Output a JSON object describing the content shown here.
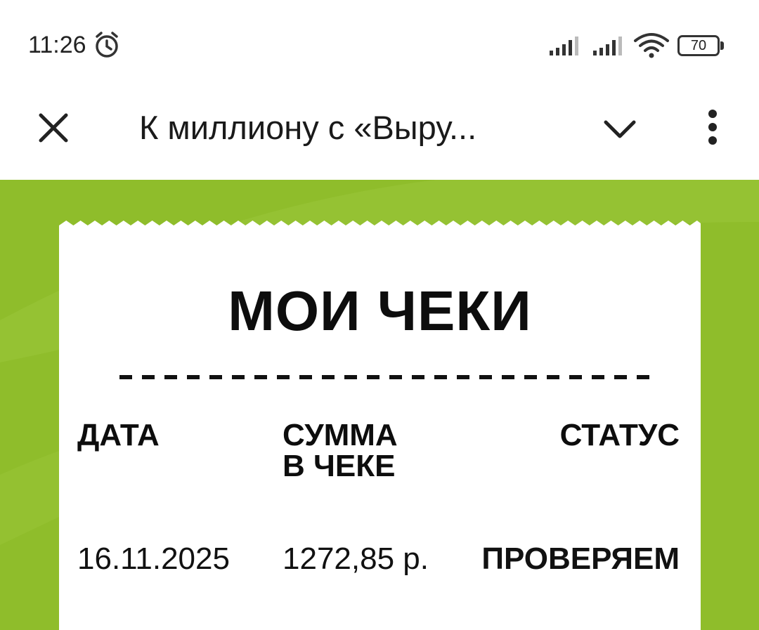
{
  "status_bar": {
    "time": "11:26",
    "battery": "70",
    "icons": [
      "alarm-icon",
      "signal-icon",
      "signal-icon",
      "wifi-icon",
      "battery-icon"
    ]
  },
  "app_bar": {
    "title": "К миллиону с «Выру...",
    "icons": [
      "close-icon",
      "chevron-down-icon",
      "more-vertical-icon"
    ]
  },
  "receipt": {
    "title": "МОИ ЧЕКИ",
    "columns": {
      "date": "ДАТА",
      "sum_line1": "СУММА",
      "sum_line2": "В ЧЕКЕ",
      "status": "СТАТУС"
    },
    "rows": [
      {
        "date": "16.11.2025",
        "sum": "1272,85 р.",
        "status": "ПРОВЕРЯЕМ"
      }
    ]
  },
  "colors": {
    "accent_green": "#8fbd2b",
    "receipt_bg": "#ffffff",
    "text": "#111111"
  }
}
